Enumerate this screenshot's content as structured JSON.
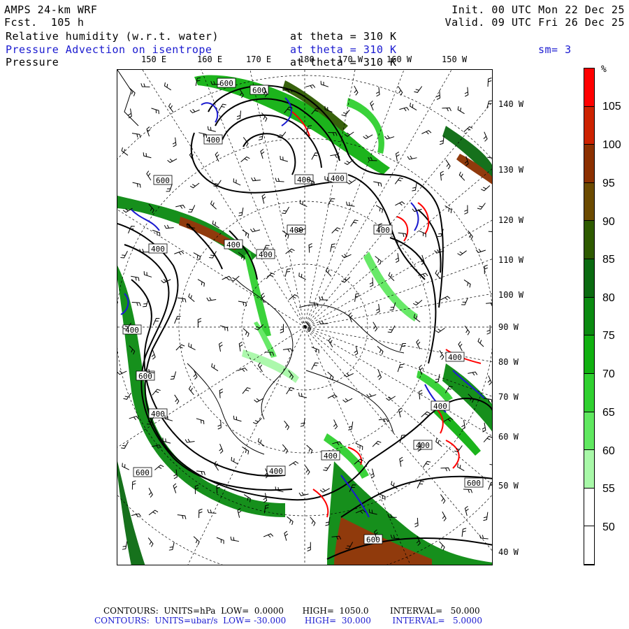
{
  "header": {
    "model": "AMPS 24-km WRF",
    "forecast": "Fcst.  105 h",
    "init": "Init. 00 UTC Mon 22 Dec 25",
    "valid": "Valid. 09 UTC Fri 26 Dec 25",
    "field1": "Relative humidity (w.r.t. water)",
    "field1_level": "at theta = 310 K",
    "field2": "Pressure Advection on isentrope",
    "field2_level": "at theta = 310 K",
    "smoothing": "sm= 3",
    "field3": "Pressure",
    "field3_level": "at theta = 310 K"
  },
  "longitude_labels_top": [
    "150 E",
    "160 E",
    "170 E",
    "180",
    "170 W",
    "160 W",
    "150 W"
  ],
  "longitude_labels_right": [
    "140 W",
    "130 W",
    "120 W",
    "110 W",
    "100 W",
    "90 W",
    "80 W",
    "70 W",
    "60 W",
    "50 W",
    "40 W"
  ],
  "contour_labels": [
    "600",
    "600",
    "400",
    "600",
    "400",
    "400",
    "400",
    "400",
    "400",
    "400",
    "400",
    "400",
    "600",
    "400",
    "400",
    "400",
    "400",
    "400",
    "400",
    "400",
    "600",
    "600",
    "600"
  ],
  "colorbar": {
    "unit": "%",
    "labels": [
      "105",
      "100",
      "95",
      "90",
      "85",
      "80",
      "75",
      "70",
      "65",
      "60",
      "55",
      "50"
    ],
    "colors": [
      "#ff0000",
      "#cc2200",
      "#8b3000",
      "#6b4a00",
      "#2e5a00",
      "#0a6a10",
      "#0a8a10",
      "#10b010",
      "#30d030",
      "#60e860",
      "#a8f8a8",
      "#ffffff",
      "#ffffff"
    ]
  },
  "footer": {
    "line1": "CONTOURS:  UNITS=hPa  LOW=  0.0000       HIGH=  1050.0        INTERVAL=   50.000",
    "line2": "CONTOURS:  UNITS=ubar/s  LOW= -30.000       HIGH=  30.000        INTERVAL=   5.0000"
  }
}
